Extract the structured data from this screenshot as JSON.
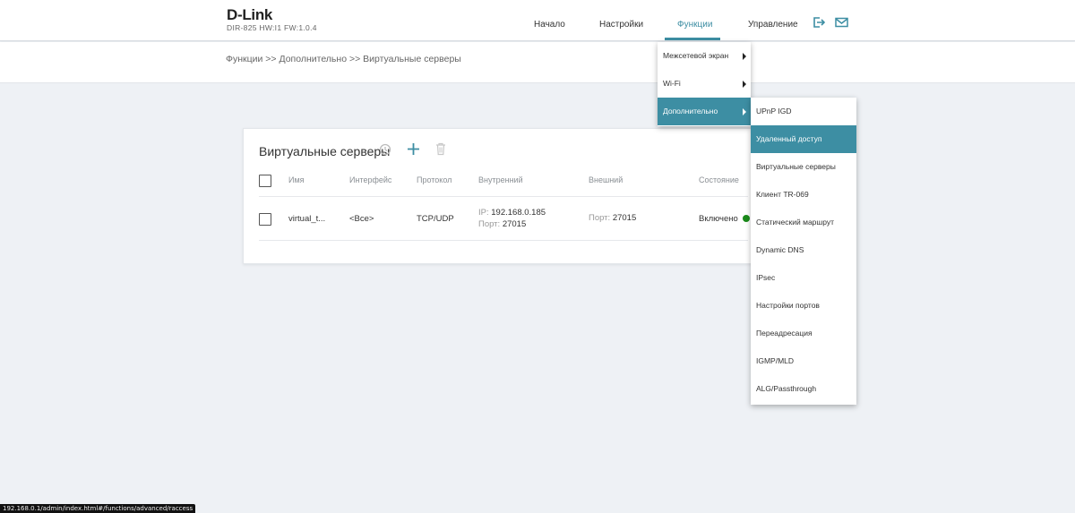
{
  "header": {
    "logo": "D-Link",
    "model": "DIR-825 HW:I1 FW:1.0.4",
    "nav": {
      "home": "Начало",
      "settings": "Настройки",
      "functions": "Функции",
      "management": "Управление"
    },
    "accent_color": "#3d8ea3",
    "icons": [
      "logout-icon",
      "mail-icon"
    ]
  },
  "breadcrumb": "Функции >> Дополнительно >> Виртуальные серверы",
  "card": {
    "title": "Виртуальные серверы",
    "icons": [
      "history-icon",
      "add-icon",
      "delete-icon"
    ],
    "columns": {
      "name": "Имя",
      "interface": "Интерфейс",
      "protocol": "Протокол",
      "internal": "Внутренний",
      "external": "Внешний",
      "status": "Состояние"
    },
    "row": {
      "name": "virtual_t...",
      "interface": "<Все>",
      "protocol": "TCP/UDP",
      "ip_label": "IP:",
      "ip": "192.168.0.185",
      "int_port_label": "Порт:",
      "int_port": "27015",
      "ext_port_label": "Порт:",
      "ext_port": "27015",
      "status": "Включено",
      "status_color": "#1a8a1a"
    }
  },
  "menu_functions": [
    "Межсетевой экран",
    "Wi-Fi",
    "Дополнительно"
  ],
  "menu_advanced": [
    "UPnP IGD",
    "Удаленный доступ",
    "Виртуальные серверы",
    "Клиент TR-069",
    "Статический маршрут",
    "Dynamic DNS",
    "IPsec",
    "Настройки портов",
    "Переадресация",
    "IGMP/MLD",
    "ALG/Passthrough"
  ],
  "status_url": "192.168.0.1/admin/index.html#/functions/advanced/raccess"
}
